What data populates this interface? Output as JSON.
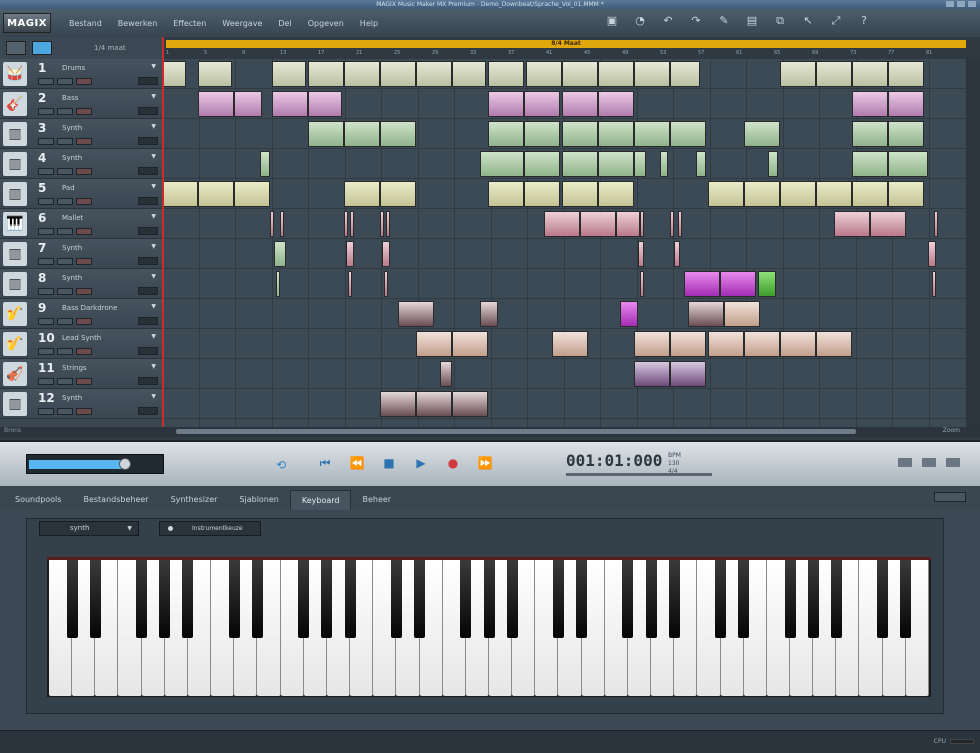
{
  "window": {
    "title": "MAGIX Music Maker MX Premium  -  Demo_Downbeat/Sprache_Vol_01.MMM *"
  },
  "menubar": {
    "logo": "MAGIX",
    "items": [
      "Bestand",
      "Bewerken",
      "Effecten",
      "Weergave",
      "Del",
      "Opgeven",
      "Help"
    ]
  },
  "arrange_header": {
    "bars_label": "1/4 maat"
  },
  "ruler": {
    "label": "8/4 Maat",
    "ticks": [
      "1",
      "5",
      "9",
      "13",
      "17",
      "21",
      "25",
      "29",
      "33",
      "37",
      "41",
      "45",
      "49",
      "53",
      "57",
      "61",
      "65",
      "69",
      "73",
      "77",
      "81"
    ]
  },
  "tracks": [
    {
      "num": "1",
      "name": "Drums",
      "icon": "drum-icon"
    },
    {
      "num": "2",
      "name": "Bass",
      "icon": "guitar-icon"
    },
    {
      "num": "3",
      "name": "Synth",
      "icon": "synth-icon"
    },
    {
      "num": "4",
      "name": "Synth",
      "icon": "synth-icon"
    },
    {
      "num": "5",
      "name": "Pad",
      "icon": "synth-icon"
    },
    {
      "num": "6",
      "name": "Mallet",
      "icon": "mallet-icon"
    },
    {
      "num": "7",
      "name": "Synth",
      "icon": "synth-icon"
    },
    {
      "num": "8",
      "name": "Synth",
      "icon": "synth-icon"
    },
    {
      "num": "9",
      "name": "Bass Darkdrone",
      "icon": "sound-fx-icon"
    },
    {
      "num": "10",
      "name": "Lead Synth",
      "icon": "sound-fx-icon"
    },
    {
      "num": "11",
      "name": "Strings",
      "icon": "violin-icon"
    },
    {
      "num": "12",
      "name": "Synth",
      "icon": "synth-icon"
    }
  ],
  "footer_left": "Brons",
  "scroll": {
    "zoom_label": "Zoom"
  },
  "transport": {
    "timecode": "001:01:000",
    "bpm_label": "BPM",
    "bpm_value": "130",
    "signature": "4/4"
  },
  "tabs": [
    "Soundpools",
    "Bestandsbeheer",
    "Synthesizer",
    "Sjablonen",
    "Keyboard",
    "Beheer"
  ],
  "active_tab": "Keyboard",
  "keyboard": {
    "synth_select": "synth",
    "instrument_button": "Instrumentkeuze"
  },
  "status": {
    "cpu_label": "CPU"
  }
}
